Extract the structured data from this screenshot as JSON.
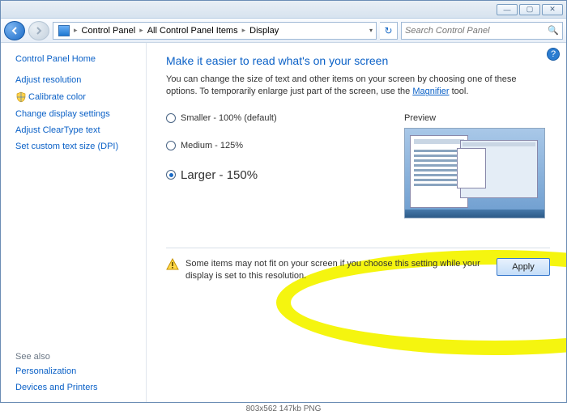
{
  "title_buttons": {
    "min": "—",
    "max": "▢",
    "close": "✕"
  },
  "breadcrumb": [
    "Control Panel",
    "All Control Panel Items",
    "Display"
  ],
  "search_placeholder": "Search Control Panel",
  "sidebar": {
    "home": "Control Panel Home",
    "links": [
      "Adjust resolution",
      "Calibrate color",
      "Change display settings",
      "Adjust ClearType text",
      "Set custom text size (DPI)"
    ],
    "see_also_hdr": "See also",
    "see_also": [
      "Personalization",
      "Devices and Printers"
    ]
  },
  "main": {
    "heading": "Make it easier to read what's on your screen",
    "intro1": "You can change the size of text and other items on your screen by choosing one of these options. To temporarily enlarge just part of the screen, use the ",
    "intro_link": "Magnifier",
    "intro2": " tool.",
    "options": [
      {
        "label": "Smaller - 100% (default)",
        "selected": false
      },
      {
        "label": "Medium - 125%",
        "selected": false
      },
      {
        "label": "Larger - 150%",
        "selected": true
      }
    ],
    "preview_label": "Preview",
    "warning": "Some items may not fit on your screen if you choose this setting while your display is set to this resolution.",
    "apply": "Apply"
  },
  "footer": "803x562  147kb  PNG"
}
